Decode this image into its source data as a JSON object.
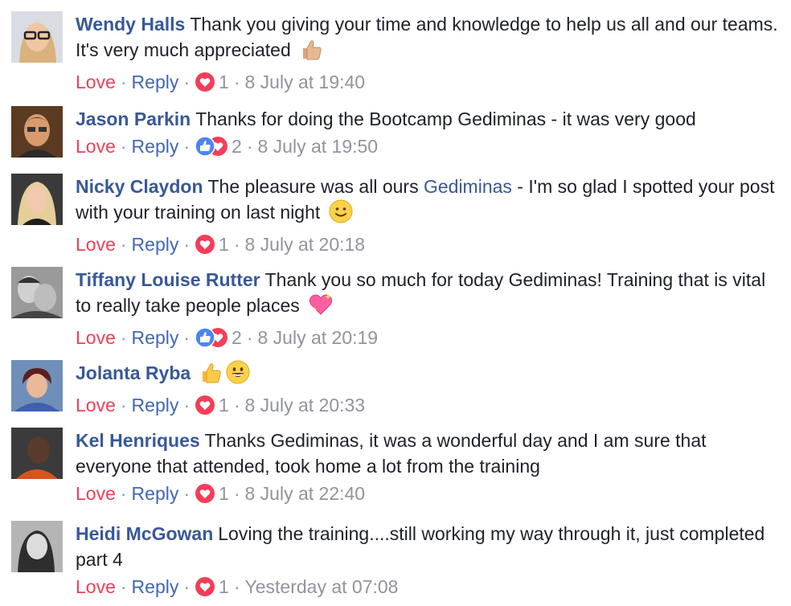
{
  "actions": {
    "love": "Love",
    "reply": "Reply",
    "dot": "·"
  },
  "colors": {
    "name": "#385898",
    "love": "#f33e58",
    "reply": "#4267b2",
    "meta": "#90949c",
    "like_blue": "#1877f2"
  },
  "comments": [
    {
      "author": "Wendy Halls",
      "text": "Thank you giving your time and knowledge to help us all and our teams. It's very much appreciated",
      "emoji": "thumbs-up-light-skin",
      "reaction": "heart",
      "count": "1",
      "time": "8 July at 19:40"
    },
    {
      "author": "Jason Parkin",
      "text": "Thanks for doing the Bootcamp Gediminas - it was very good",
      "reaction": "like-heart",
      "count": "2",
      "time": "8 July at 19:50"
    },
    {
      "author": "Nicky Claydon",
      "text_before": "The pleasure was all ours",
      "mention": "Gediminas",
      "text_after": "- I'm so glad I spotted your post with your training on last night",
      "emoji": "slightly-smiling-face",
      "reaction": "heart",
      "count": "1",
      "time": "8 July at 20:18"
    },
    {
      "author": "Tiffany Louise Rutter",
      "text": "Thank you so much for today Gediminas! Training that is vital to really take people places",
      "emoji": "sparkling-heart",
      "reaction": "like-heart",
      "count": "2",
      "time": "8 July at 20:19"
    },
    {
      "author": "Jolanta Ryba",
      "text": "",
      "emoji": "thumbs-up + grinning-face",
      "reaction": "heart",
      "count": "1",
      "time": "8 July at 20:33"
    },
    {
      "author": "Kel Henriques",
      "text": "Thanks Gediminas, it was a wonderful day and I am sure that everyone that attended, took home a lot from the training",
      "reaction": "heart",
      "count": "1",
      "time": "8 July at 22:40"
    },
    {
      "author": "Heidi McGowan",
      "text": "Loving the training....still working my way through it, just completed part 4",
      "reaction": "heart",
      "count": "1",
      "time": "Yesterday at 07:08"
    }
  ]
}
